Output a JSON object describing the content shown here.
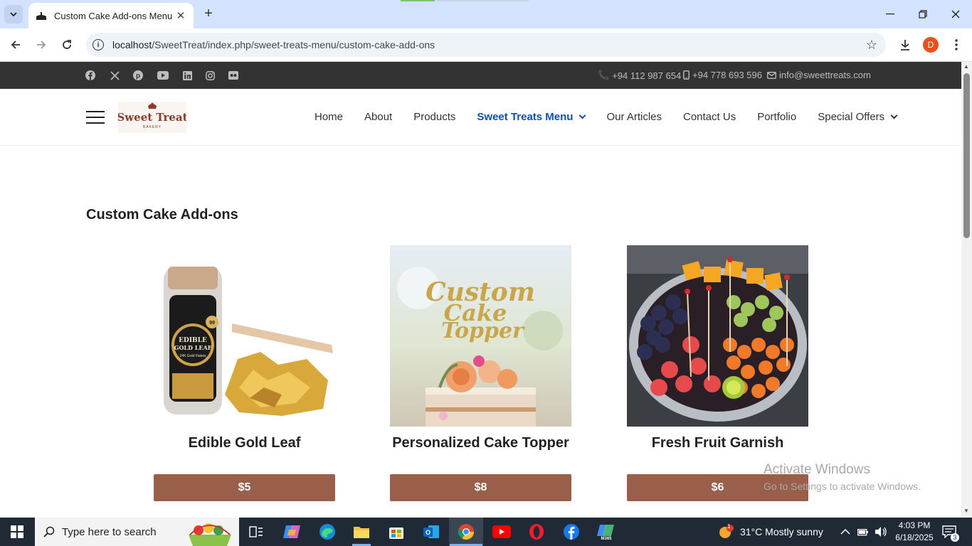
{
  "browser": {
    "tab_title": "Custom Cake Add-ons Menu",
    "url_host": "localhost",
    "url_path": "/SweetTreat/index.php/sweet-treats-menu/custom-cake-add-ons",
    "profile_initial": "D"
  },
  "topbar": {
    "social_icons": [
      "facebook-icon",
      "x-icon",
      "pinterest-icon",
      "youtube-icon",
      "linkedin-icon",
      "instagram-icon",
      "flickr-icon"
    ],
    "phone": "+94 112 987 654",
    "mobile": "+94 778 693 596",
    "email": "info@sweettreats.com"
  },
  "header": {
    "logo_text": "Sweet Treat",
    "logo_sub": "BAKERY",
    "menu": [
      {
        "label": "Home",
        "active": false,
        "dropdown": false
      },
      {
        "label": "About",
        "active": false,
        "dropdown": false
      },
      {
        "label": "Products",
        "active": false,
        "dropdown": false
      },
      {
        "label": "Sweet Treats Menu",
        "active": true,
        "dropdown": true
      },
      {
        "label": "Our Articles",
        "active": false,
        "dropdown": false
      },
      {
        "label": "Contact Us",
        "active": false,
        "dropdown": false
      },
      {
        "label": "Portfolio",
        "active": false,
        "dropdown": false
      },
      {
        "label": "Special Offers",
        "active": false,
        "dropdown": true
      }
    ]
  },
  "main": {
    "title": "Custom Cake Add-ons",
    "products": [
      {
        "name": "Edible Gold Leaf",
        "price": "$5",
        "image_label": "EDIBLE GOLD LEAF",
        "image_sub": "24K Gold Flakes"
      },
      {
        "name": "Personalized Cake Topper",
        "price": "$8",
        "image_label": "Custom Cake Topper"
      },
      {
        "name": "Fresh Fruit Garnish",
        "price": "$6"
      }
    ]
  },
  "watermark": {
    "line1": "Activate Windows",
    "line2": "Go to Settings to activate Windows."
  },
  "taskbar": {
    "search_placeholder": "Type here to search",
    "weather": "31°C  Mostly sunny",
    "weather_badge": "1",
    "time": "4:03 PM",
    "date": "6/18/2025",
    "notifications": "3"
  },
  "colors": {
    "topbar_bg": "#333333",
    "active_menu": "#0d4fb5",
    "price_button": "#9a5f4b",
    "tab_strip": "#d3e3fd",
    "taskbar": "#1f2a36"
  }
}
